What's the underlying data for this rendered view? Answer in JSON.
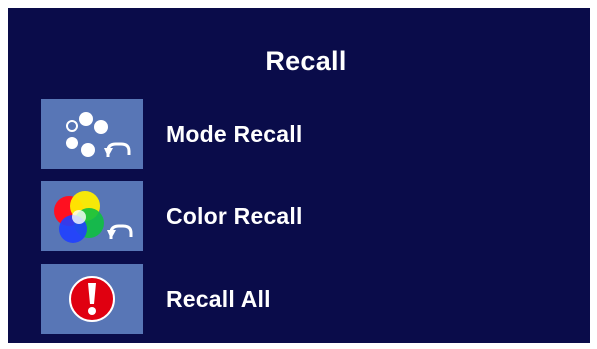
{
  "menu": {
    "title": "Recall",
    "items": [
      {
        "label": "Mode Recall",
        "icon": "mode-recall-icon"
      },
      {
        "label": "Color Recall",
        "icon": "color-recall-icon"
      },
      {
        "label": "Recall All",
        "icon": "recall-all-icon"
      }
    ]
  },
  "colors": {
    "panel_background": "#0a0c4a",
    "icon_tile": "#5876b6",
    "text": "#ffffff",
    "alert_red": "#e00010"
  }
}
